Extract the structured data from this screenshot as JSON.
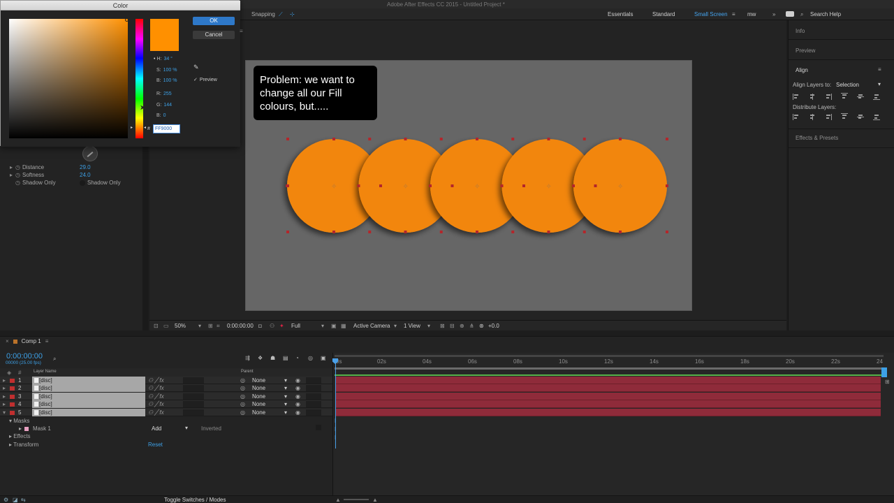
{
  "app": {
    "window_title": "Adobe After Effects CC 2015 - Untitled Project *"
  },
  "toolbar": {
    "snapping_label": "Snapping",
    "workspaces": [
      {
        "label": "Essentials",
        "active": false
      },
      {
        "label": "Standard",
        "active": false
      },
      {
        "label": "Small Screen",
        "active": true
      },
      {
        "label": "mw",
        "active": false
      }
    ],
    "search_placeholder": "Search Help"
  },
  "color_dialog": {
    "title": "Color",
    "ok_label": "OK",
    "cancel_label": "Cancel",
    "preview_label": "Preview",
    "fields": [
      {
        "label": "H:",
        "value": "34 °"
      },
      {
        "label": "S:",
        "value": "100 %"
      },
      {
        "label": "B:",
        "value": "100 %"
      },
      {
        "label": "R:",
        "value": "255"
      },
      {
        "label": "G:",
        "value": "144"
      },
      {
        "label": "B:",
        "value": "0"
      }
    ],
    "hex_value": "FF9000",
    "color": "#ff9000"
  },
  "effect_controls": {
    "props": [
      {
        "label": "Distance",
        "value": "29.0"
      },
      {
        "label": "Softness",
        "value": "24.0"
      },
      {
        "label": "Shadow Only",
        "value": "Shadow Only"
      }
    ]
  },
  "composition": {
    "note_text": "Problem: we want to change all our Fill colours, but.....",
    "disc_color": "#f2860f",
    "disc_count": 5
  },
  "viewer_bar": {
    "zoom": "50%",
    "timecode": "0:00:00:00",
    "resolution": "Full",
    "camera": "Active Camera",
    "views": "1 View",
    "exposure": "+0.0"
  },
  "right_panel": {
    "info": "Info",
    "preview": "Preview",
    "align": "Align",
    "align_to_label": "Align Layers to:",
    "align_to_value": "Selection",
    "distribute_label": "Distribute Layers:",
    "effects_presets": "Effects & Presets"
  },
  "timeline": {
    "tab_label": "Comp 1",
    "timecode": "0:00:00:00",
    "frames": "00000 (25.00 fps)",
    "col_layer_name": "Layer Name",
    "col_parent": "Parent",
    "ruler": [
      "0s",
      "02s",
      "04s",
      "06s",
      "08s",
      "10s",
      "12s",
      "14s",
      "16s",
      "18s",
      "20s",
      "22s",
      "24"
    ],
    "layers": [
      {
        "num": "1",
        "name": "[disc]",
        "parent": "None"
      },
      {
        "num": "2",
        "name": "[disc]",
        "parent": "None"
      },
      {
        "num": "3",
        "name": "[disc]",
        "parent": "None"
      },
      {
        "num": "4",
        "name": "[disc]",
        "parent": "None"
      },
      {
        "num": "5",
        "name": "[disc]",
        "parent": "None"
      }
    ],
    "sub": {
      "masks": "Masks",
      "mask1": "Mask 1",
      "mask_mode": "Add",
      "inverted": "Inverted",
      "effects": "Effects",
      "transform": "Transform",
      "reset": "Reset"
    },
    "toggle_label": "Toggle Switches / Modes"
  }
}
